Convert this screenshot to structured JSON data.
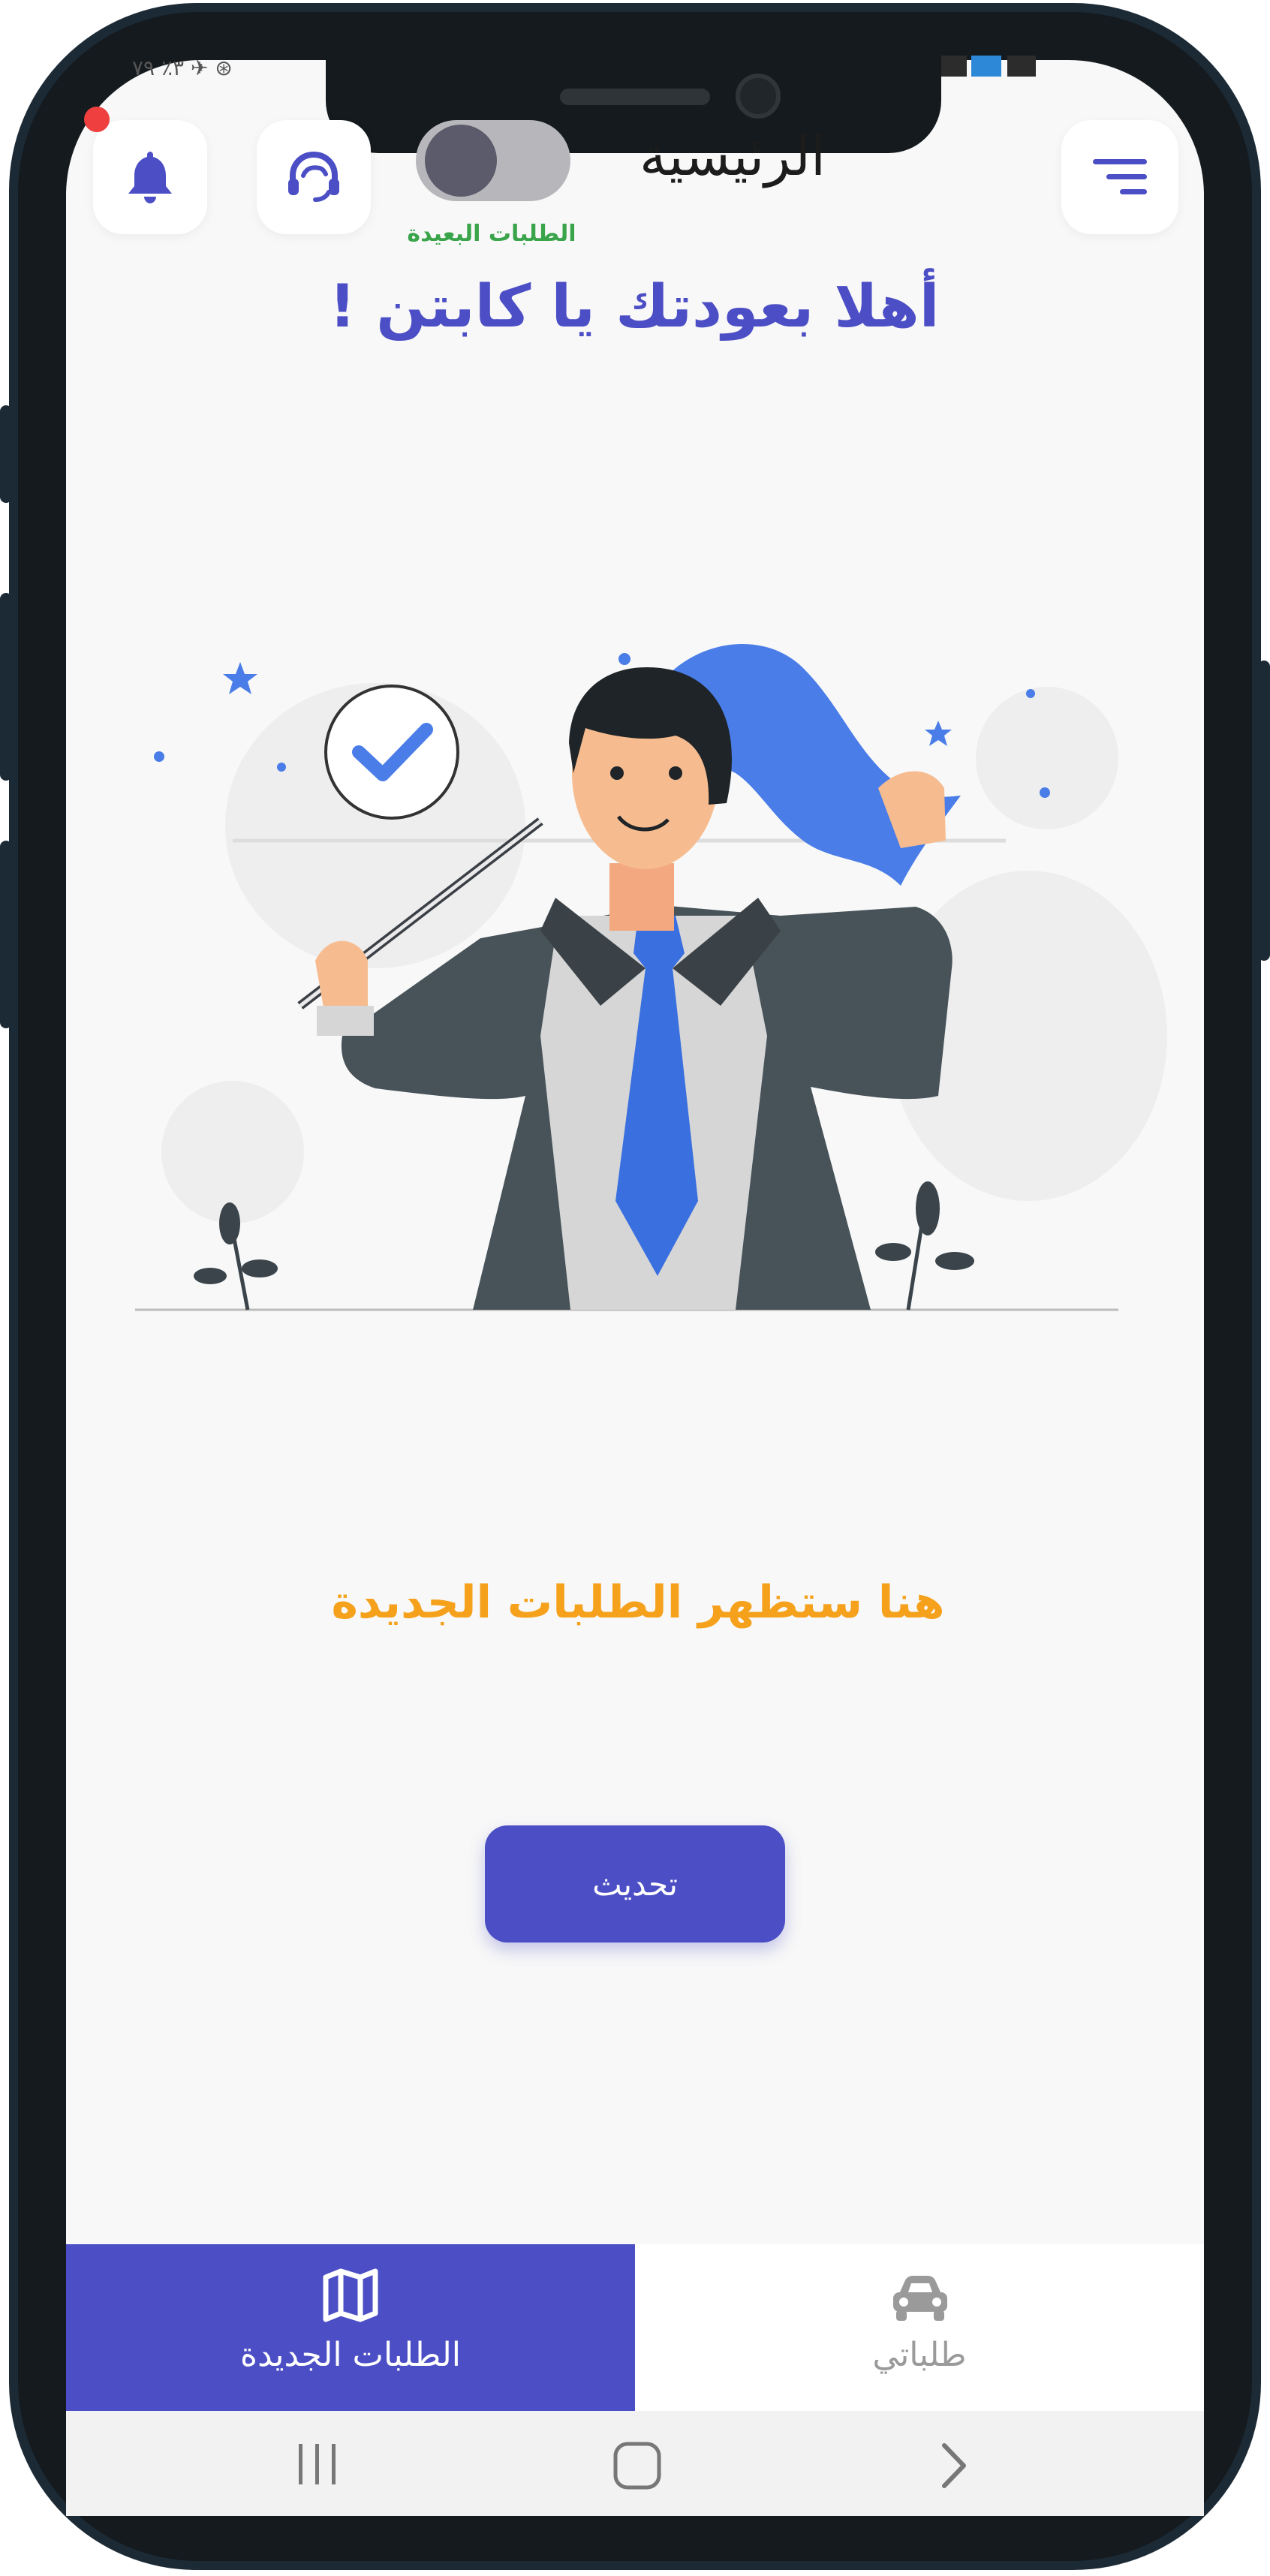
{
  "header": {
    "title": "الرئيسية",
    "toggle_label": "الطلبات البعيدة",
    "menu_icon": "menu-filter-icon",
    "support_icon": "headset-support-icon",
    "notifications_icon": "bell-icon"
  },
  "status_bar": {
    "left_text": "٣٪ ٧٩ ✈ ⊛"
  },
  "welcome": {
    "text": "أهلا بعودتك يا كابتن !"
  },
  "empty_state": {
    "text": "هنا ستظهر الطلبات الجديدة"
  },
  "actions": {
    "refresh_label": "تحديث"
  },
  "bottom_tabs": [
    {
      "label": "الطلبات الجديدة",
      "icon": "map-icon",
      "active": true
    },
    {
      "label": "طلباتي",
      "icon": "car-icon",
      "active": false
    }
  ],
  "system_nav": {
    "recents_icon": "recents-icon",
    "home_icon": "home-icon",
    "back_icon": "back-icon"
  },
  "colors": {
    "primary": "#4b4ec4",
    "accent": "#f5a11b",
    "success": "#3aa44a",
    "alert": "#ef3f3f"
  }
}
